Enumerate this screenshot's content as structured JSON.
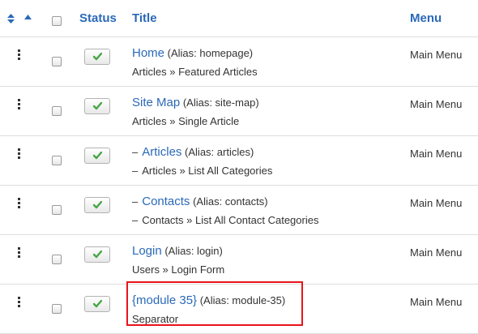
{
  "header": {
    "status_label": "Status",
    "title_label": "Title",
    "menu_label": "Menu"
  },
  "rows": [
    {
      "title": "Home",
      "alias": "(Alias: homepage)",
      "sub": "Articles » Featured Articles",
      "menu": "Main Menu",
      "level": 1,
      "published": true
    },
    {
      "title": "Site Map",
      "alias": "(Alias: site-map)",
      "sub": "Articles » Single Article",
      "menu": "Main Menu",
      "level": 1,
      "published": true
    },
    {
      "title": "Articles",
      "alias": "(Alias: articles)",
      "sub": "Articles » List All Categories",
      "menu": "Main Menu",
      "level": 2,
      "published": true
    },
    {
      "title": "Contacts",
      "alias": "(Alias: contacts)",
      "sub": "Contacts » List All Contact Categories",
      "menu": "Main Menu",
      "level": 2,
      "published": true
    },
    {
      "title": "Login",
      "alias": "(Alias: login)",
      "sub": "Users » Login Form",
      "menu": "Main Menu",
      "level": 1,
      "published": true
    },
    {
      "title": "{module 35}",
      "alias": "(Alias: module-35)",
      "sub": "Separator",
      "menu": "Main Menu",
      "level": 1,
      "published": true
    }
  ],
  "level_prefix": "–",
  "icons": {
    "sort": "sort-icon",
    "ascending": "caret-up-icon",
    "drag": "drag-handle-icon",
    "published": "checkmark-icon"
  },
  "colors": {
    "link": "#2a69b8",
    "check": "#46a546",
    "highlight": "#e8141b",
    "border": "#dddddd"
  }
}
